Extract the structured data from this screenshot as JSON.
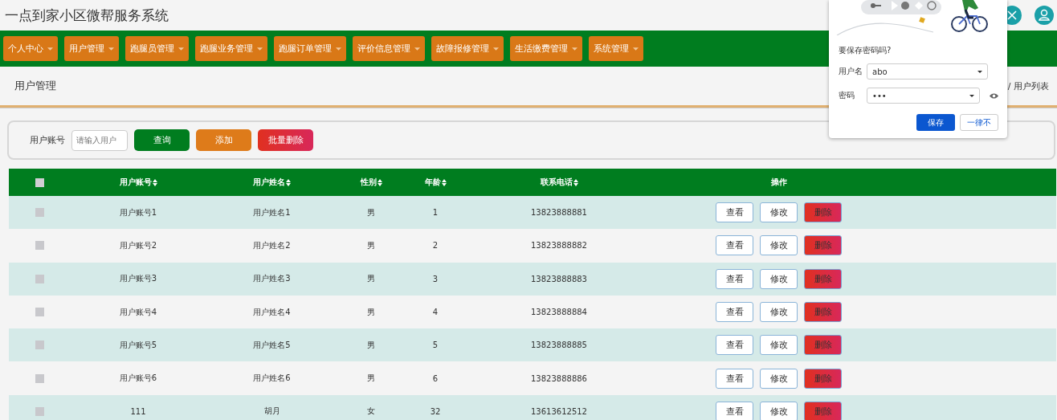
{
  "header": {
    "title": "一点到家小区微帮服务系统"
  },
  "nav": [
    {
      "label": "个人中心"
    },
    {
      "label": "用户管理"
    },
    {
      "label": "跑腿员管理"
    },
    {
      "label": "跑腿业务管理"
    },
    {
      "label": "跑腿订单管理"
    },
    {
      "label": "评价信息管理"
    },
    {
      "label": "故障报修管理"
    },
    {
      "label": "生活缴费管理"
    },
    {
      "label": "系统管理"
    }
  ],
  "page_title": "用户管理",
  "breadcrumb": "/ 用户列表",
  "search": {
    "label": "用户账号",
    "placeholder": "请输入用户",
    "buttons": [
      {
        "label": "查询",
        "kind": "query"
      },
      {
        "label": "添加",
        "kind": "add"
      },
      {
        "label": "批量删除",
        "kind": "delete"
      }
    ]
  },
  "table": {
    "select_all": {
      "checked": false
    },
    "columns": [
      "用户账号",
      "用户姓名",
      "性别",
      "年龄",
      "联系电话",
      "操作"
    ],
    "rows": [
      {
        "checked": false,
        "cells": [
          "用户账号1",
          "用户姓名1",
          "男",
          "1",
          "13823888881"
        ],
        "actions": [
          {
            "label": "查看",
            "kind": "view"
          },
          {
            "label": "修改",
            "kind": "edit"
          },
          {
            "label": "删除",
            "kind": "delete"
          }
        ]
      },
      {
        "checked": false,
        "cells": [
          "用户账号2",
          "用户姓名2",
          "男",
          "2",
          "13823888882"
        ],
        "actions": [
          {
            "label": "查看",
            "kind": "view"
          },
          {
            "label": "修改",
            "kind": "edit"
          },
          {
            "label": "删除",
            "kind": "delete"
          }
        ]
      },
      {
        "checked": false,
        "cells": [
          "用户账号3",
          "用户姓名3",
          "男",
          "3",
          "13823888883"
        ],
        "actions": [
          {
            "label": "查看",
            "kind": "view"
          },
          {
            "label": "修改",
            "kind": "edit"
          },
          {
            "label": "删除",
            "kind": "delete"
          }
        ]
      },
      {
        "checked": false,
        "cells": [
          "用户账号4",
          "用户姓名4",
          "男",
          "4",
          "13823888884"
        ],
        "actions": [
          {
            "label": "查看",
            "kind": "view"
          },
          {
            "label": "修改",
            "kind": "edit"
          },
          {
            "label": "删除",
            "kind": "delete"
          }
        ]
      },
      {
        "checked": false,
        "cells": [
          "用户账号5",
          "用户姓名5",
          "男",
          "5",
          "13823888885"
        ],
        "actions": [
          {
            "label": "查看",
            "kind": "view"
          },
          {
            "label": "修改",
            "kind": "edit"
          },
          {
            "label": "删除",
            "kind": "delete"
          }
        ]
      },
      {
        "checked": false,
        "cells": [
          "用户账号6",
          "用户姓名6",
          "男",
          "6",
          "13823888886"
        ],
        "actions": [
          {
            "label": "查看",
            "kind": "view"
          },
          {
            "label": "修改",
            "kind": "edit"
          },
          {
            "label": "删除",
            "kind": "delete"
          }
        ]
      },
      {
        "checked": false,
        "cells": [
          "111",
          "胡月",
          "女",
          "32",
          "13613612512"
        ],
        "actions": [
          {
            "label": "查看",
            "kind": "view"
          },
          {
            "label": "修改",
            "kind": "edit"
          },
          {
            "label": "删除",
            "kind": "delete"
          }
        ]
      }
    ]
  },
  "password_popup": {
    "question": "要保存密码吗?",
    "fields": [
      {
        "label": "用户名",
        "value": "abo"
      },
      {
        "label": "密码",
        "value": "•••"
      }
    ],
    "buttons": [
      {
        "label": "保存",
        "kind": "primary"
      },
      {
        "label": "一律不",
        "kind": "secondary"
      }
    ]
  }
}
